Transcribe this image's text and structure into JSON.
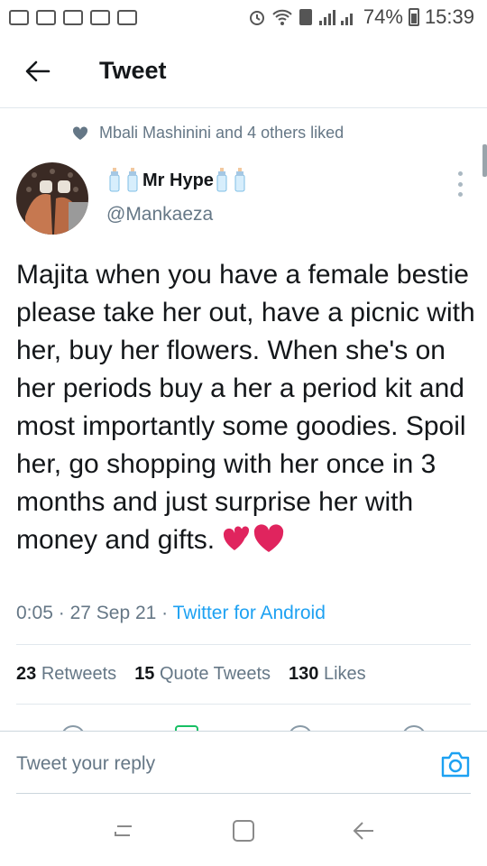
{
  "status_bar": {
    "battery": "74%",
    "time": "15:39"
  },
  "header": {
    "title": "Tweet"
  },
  "social_context": {
    "text": "Mbali Mashinini and 4 others liked"
  },
  "tweet": {
    "author_name": "Mr Hype",
    "author_handle": "@Mankaeza",
    "text": "Majita when you have a female bestie please take her out, have a picnic with her, buy her flowers. When she's on her periods buy a her a period kit and most importantly some goodies. Spoil her, go shopping with her once in 3 months and just surprise her with money and gifts.",
    "time": "0:05",
    "date": "27 Sep 21",
    "separator": "·",
    "source": "Twitter for Android"
  },
  "stats": {
    "retweets_count": "23",
    "retweets_label": "Retweets",
    "quotes_count": "15",
    "quotes_label": "Quote Tweets",
    "likes_count": "130",
    "likes_label": "Likes"
  },
  "reply": {
    "placeholder": "Tweet your reply"
  },
  "colors": {
    "accent": "#1da1f2",
    "text": "#14171a",
    "muted": "#657786",
    "heart": "#e0245e"
  }
}
